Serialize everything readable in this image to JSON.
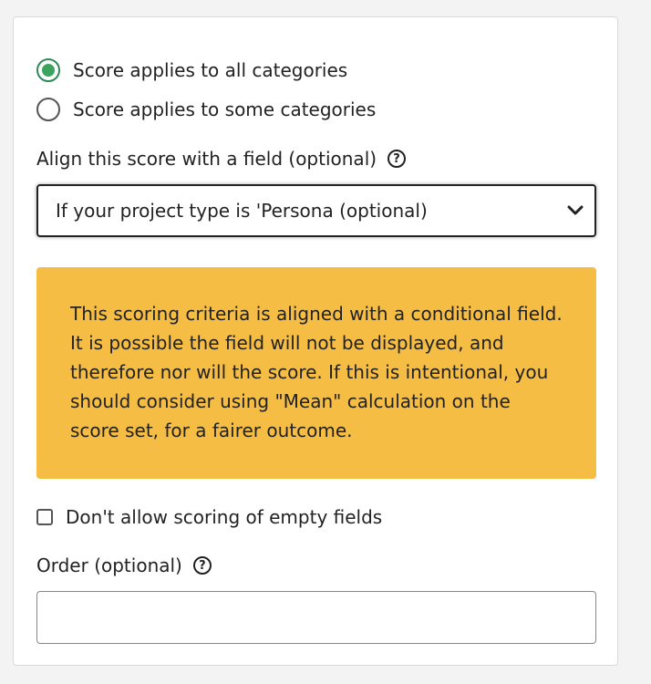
{
  "scope": {
    "options": [
      {
        "label": "Score applies to all categories",
        "selected": true
      },
      {
        "label": "Score applies to some categories",
        "selected": false
      }
    ]
  },
  "align_field": {
    "label": "Align this score with a field (optional)",
    "help_icon": "question-circle-icon",
    "selected_value": "If your project type is 'Persona (optional)"
  },
  "warning": {
    "text": "This scoring criteria is aligned with a conditional field. It is possible the field will not be displayed, and therefore nor will the score. If this is intentional, you should consider using \"Mean\" calculation on the score set, for a fairer outcome.",
    "color": "#f5bd43"
  },
  "empty_fields": {
    "label": "Don't allow scoring of empty fields",
    "checked": false
  },
  "order": {
    "label": "Order (optional)",
    "help_icon": "question-circle-icon",
    "value": ""
  },
  "colors": {
    "radio_selected": "#3aa45e"
  }
}
